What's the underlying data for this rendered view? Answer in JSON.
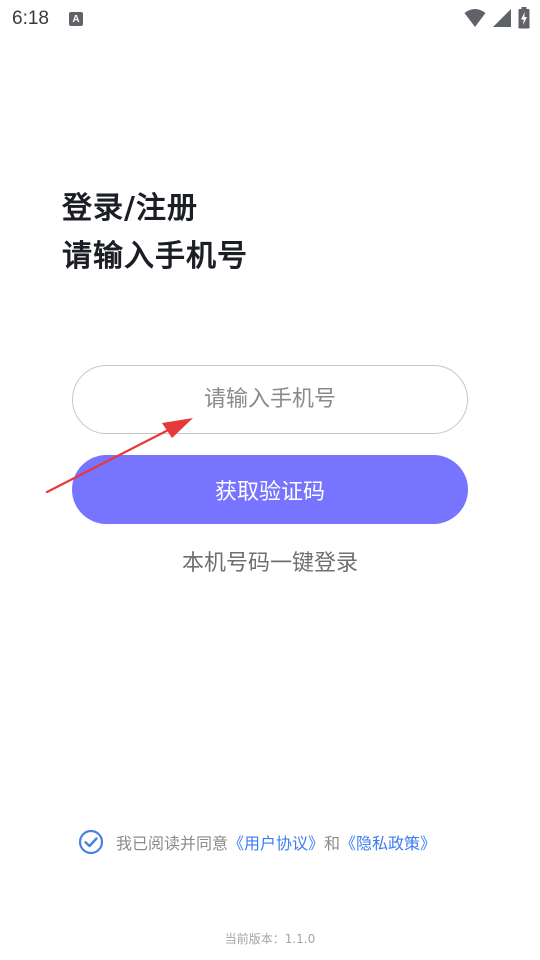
{
  "status_bar": {
    "time": "6:18",
    "notification_letter": "A"
  },
  "heading": {
    "line1": "登录/注册",
    "line2": "请输入手机号"
  },
  "phone_input": {
    "placeholder": "请输入手机号",
    "value": ""
  },
  "get_code_button": {
    "label": "获取验证码"
  },
  "one_click_login": {
    "label": "本机号码一键登录"
  },
  "agreement": {
    "prefix": "我已阅读并同意",
    "user_agreement": "《用户协议》",
    "conjunction": "和",
    "privacy_policy": "《隐私政策》",
    "checked": true
  },
  "version": {
    "text": "当前版本：1.1.0"
  },
  "colors": {
    "primary": "#7774ff",
    "link": "#3c7df0",
    "annotation_arrow": "#e5393a"
  }
}
